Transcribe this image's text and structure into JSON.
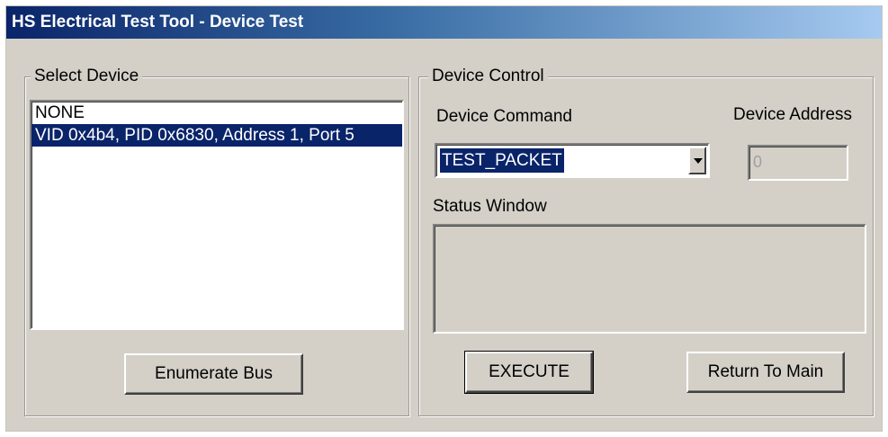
{
  "window": {
    "title": "HS Electrical Test Tool - Device Test"
  },
  "select_device": {
    "legend": "Select Device",
    "items": [
      {
        "label": "NONE",
        "selected": false
      },
      {
        "label": "VID 0x4b4, PID 0x6830, Address 1, Port 5",
        "selected": true
      }
    ],
    "enumerate_label": "Enumerate Bus"
  },
  "device_control": {
    "legend": "Device Control",
    "command_label": "Device Command",
    "command_value": "TEST_PACKET",
    "address_label": "Device Address",
    "address_value": "0",
    "status_label": "Status Window",
    "status_text": "",
    "execute_label": "EXECUTE",
    "return_label": "Return To Main"
  },
  "colors": {
    "face": "#d4d0c8",
    "selection": "#0a246a",
    "title_gradient_start": "#0a246a",
    "title_gradient_end": "#a6caf0"
  }
}
